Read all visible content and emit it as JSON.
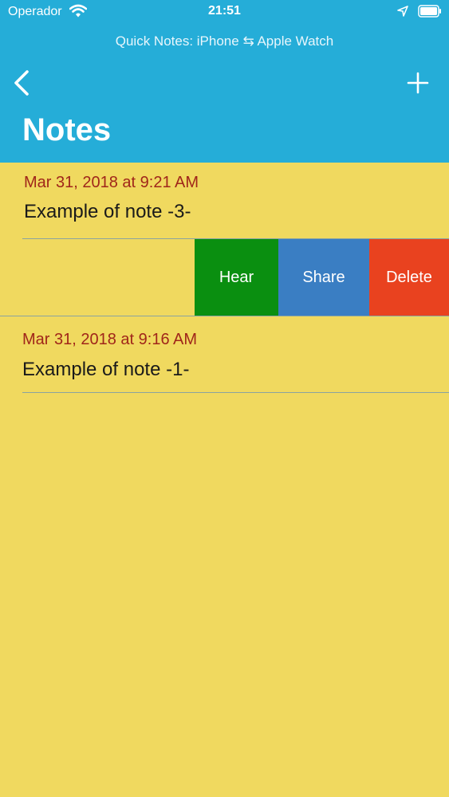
{
  "status_bar": {
    "carrier": "Operador",
    "time": "21:51"
  },
  "nav": {
    "subtitle": "Quick Notes: iPhone ⇆ Apple Watch",
    "title": "Notes",
    "back_icon": "chevron-left-icon",
    "add_icon": "plus-icon"
  },
  "notes": [
    {
      "date": "Mar 31, 2018 at 9:21 AM",
      "text": "Example of note -3-"
    },
    {
      "date": "Mar 31, 2018 at 9:16 AM",
      "text": "Example of note -1-"
    }
  ],
  "swipe_actions": {
    "hear": "Hear",
    "share": "Share",
    "delete": "Delete"
  },
  "colors": {
    "header": "#25add8",
    "background": "#f0d95f",
    "date": "#a0261a",
    "hear": "#0a8f10",
    "share": "#3a7ec3",
    "delete": "#e9421f"
  }
}
